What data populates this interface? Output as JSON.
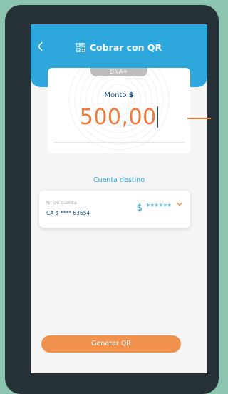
{
  "header": {
    "title": "Cobrar con QR",
    "back_icon": "chevron-left-icon",
    "title_icon": "qr-code-icon"
  },
  "card": {
    "badge": "BNA+",
    "amount_label": "Monto",
    "currency_symbol": "$",
    "amount_value": "500,00"
  },
  "destination": {
    "title": "Cuenta destino",
    "account_label": "N° de cuenta",
    "account_number": "CA $ **** 63654",
    "balance_currency": "$",
    "balance_masked": "******",
    "dropdown_icon": "chevron-down-icon"
  },
  "actions": {
    "generate_label": "Generar QR"
  },
  "colors": {
    "brand_blue": "#2ea8dc",
    "accent_orange": "#f07a3a",
    "button_orange": "#f0914e",
    "dark_blue": "#1b4f8a",
    "frame": "#263238",
    "background": "#8cc5b0"
  }
}
